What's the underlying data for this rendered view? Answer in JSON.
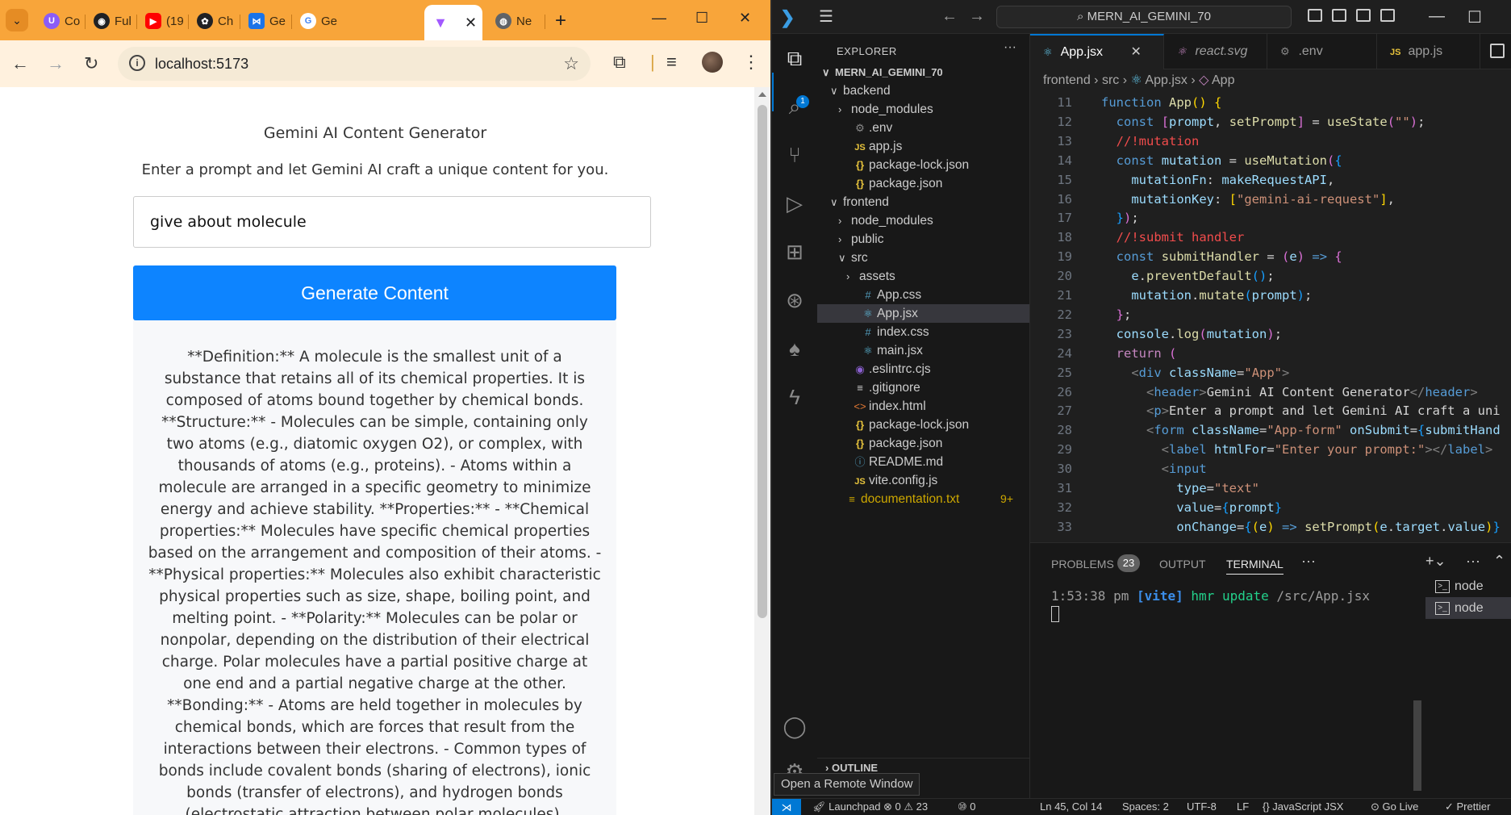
{
  "browser": {
    "tabs": [
      {
        "label": "Co",
        "icon": "u-circle-icon",
        "color": "#8b5cf6"
      },
      {
        "label": "Ful",
        "icon": "github-icon",
        "color": "#202124"
      },
      {
        "label": "(19",
        "icon": "youtube-icon",
        "color": "#ff0000"
      },
      {
        "label": "Ch",
        "icon": "chatgpt-icon",
        "color": "#202124"
      },
      {
        "label": "Ge",
        "icon": "butterfly-icon",
        "color": "#1a73e8"
      },
      {
        "label": "Ge",
        "icon": "google-icon",
        "color": "#4285f4"
      },
      {
        "label": "",
        "icon": "vite-icon",
        "color": "#a259ff"
      },
      {
        "label": "Ne",
        "icon": "globe-icon",
        "color": "#5f6368"
      }
    ],
    "url": "localhost:5173"
  },
  "app": {
    "header": "Gemini AI Content Generator",
    "description": "Enter a prompt and let Gemini AI craft a unique content for you.",
    "prompt_value": "give about molecule",
    "button_label": "Generate Content",
    "result_text": "**Definition:** A molecule is the smallest unit of a substance that retains all of its chemical properties. It is composed of atoms bound together by chemical bonds. **Structure:** - Molecules can be simple, containing only two atoms (e.g., diatomic oxygen O2), or complex, with thousands of atoms (e.g., proteins). - Atoms within a molecule are arranged in a specific geometry to minimize energy and achieve stability. **Properties:** - **Chemical properties:** Molecules have specific chemical properties based on the arrangement and composition of their atoms. - **Physical properties:** Molecules also exhibit characteristic physical properties such as size, shape, boiling point, and melting point. - **Polarity:** Molecules can be polar or nonpolar, depending on the distribution of their electrical charge. Polar molecules have a partial positive charge at one end and a partial negative charge at the other. **Bonding:** - Atoms are held together in molecules by chemical bonds, which are forces that result from the interactions between their electrons. - Common types of bonds include covalent bonds (sharing of electrons), ionic bonds (transfer of electrons), and hydrogen bonds (electrostatic attraction between polar molecules). **Biological"
  },
  "vscode": {
    "command_center": "MERN_AI_GEMINI_70",
    "explorer_title": "EXPLORER",
    "explorer_badge": "1",
    "project_name": "MERN_AI_GEMINI_70",
    "tree": [
      {
        "label": "MERN_AI_GEMINI_70",
        "depth": 0,
        "chev": "∨",
        "icon": "",
        "kind": "root"
      },
      {
        "label": "backend",
        "depth": 1,
        "chev": "∨",
        "icon": "",
        "kind": "folder"
      },
      {
        "label": "node_modules",
        "depth": 2,
        "chev": "›",
        "icon": "",
        "kind": "folder"
      },
      {
        "label": ".env",
        "depth": 2,
        "chev": "",
        "icon": "⚙",
        "kind": "gear"
      },
      {
        "label": "app.js",
        "depth": 2,
        "chev": "",
        "icon": "JS",
        "kind": "js"
      },
      {
        "label": "package-lock.json",
        "depth": 2,
        "chev": "",
        "icon": "{}",
        "kind": "json"
      },
      {
        "label": "package.json",
        "depth": 2,
        "chev": "",
        "icon": "{}",
        "kind": "json"
      },
      {
        "label": "frontend",
        "depth": 1,
        "chev": "∨",
        "icon": "",
        "kind": "folder"
      },
      {
        "label": "node_modules",
        "depth": 2,
        "chev": "›",
        "icon": "",
        "kind": "folder"
      },
      {
        "label": "public",
        "depth": 2,
        "chev": "›",
        "icon": "",
        "kind": "folder"
      },
      {
        "label": "src",
        "depth": 2,
        "chev": "∨",
        "icon": "",
        "kind": "folder"
      },
      {
        "label": "assets",
        "depth": 3,
        "chev": "›",
        "icon": "",
        "kind": "folder"
      },
      {
        "label": "App.css",
        "depth": 3,
        "chev": "",
        "icon": "#",
        "kind": "css"
      },
      {
        "label": "App.jsx",
        "depth": 3,
        "chev": "",
        "icon": "⚛",
        "kind": "jsx",
        "selected": true
      },
      {
        "label": "index.css",
        "depth": 3,
        "chev": "",
        "icon": "#",
        "kind": "css"
      },
      {
        "label": "main.jsx",
        "depth": 3,
        "chev": "",
        "icon": "⚛",
        "kind": "jsx"
      },
      {
        "label": ".eslintrc.cjs",
        "depth": 2,
        "chev": "",
        "icon": "◉",
        "kind": "eslint"
      },
      {
        "label": ".gitignore",
        "depth": 2,
        "chev": "",
        "icon": "≡",
        "kind": "txt"
      },
      {
        "label": "index.html",
        "depth": 2,
        "chev": "",
        "icon": "<>",
        "kind": "html"
      },
      {
        "label": "package-lock.json",
        "depth": 2,
        "chev": "",
        "icon": "{}",
        "kind": "json"
      },
      {
        "label": "package.json",
        "depth": 2,
        "chev": "",
        "icon": "{}",
        "kind": "json"
      },
      {
        "label": "README.md",
        "depth": 2,
        "chev": "",
        "icon": "ⓘ",
        "kind": "info"
      },
      {
        "label": "vite.config.js",
        "depth": 2,
        "chev": "",
        "icon": "JS",
        "kind": "js"
      },
      {
        "label": "documentation.txt",
        "depth": 1,
        "chev": "",
        "icon": "≡",
        "kind": "warn",
        "badge": "9+"
      }
    ],
    "outline_label": "OUTLINE",
    "tooltip": "Open a Remote Window",
    "editor_tabs": [
      {
        "label": "App.jsx",
        "icon": "⚛",
        "active": true
      },
      {
        "label": "react.svg",
        "icon": "⚛",
        "active": false
      },
      {
        "label": ".env",
        "icon": "⚙",
        "active": false
      },
      {
        "label": "app.js",
        "icon": "JS",
        "active": false
      }
    ],
    "breadcrumbs": [
      "frontend",
      "src",
      "App.jsx",
      "App"
    ],
    "code_lines": [
      {
        "n": "11",
        "html": "<span class='k'>function</span> <span class='f'>App</span><span class='br1'>()</span> <span class='br1'>{</span>"
      },
      {
        "n": "12",
        "html": "  <span class='k'>const</span> <span class='br2'>[</span><span class='v'>prompt</span>, <span class='f'>setPrompt</span><span class='br2'>]</span> = <span class='f'>useState</span><span class='br2'>(</span><span class='s'>\"\"</span><span class='br2'>)</span>;"
      },
      {
        "n": "13",
        "html": "  <span class='c'>//!mutation</span>"
      },
      {
        "n": "14",
        "html": "  <span class='k'>const</span> <span class='v'>mutation</span> = <span class='f'>useMutation</span><span class='br2'>(</span><span class='br3'>{</span>"
      },
      {
        "n": "15",
        "html": "    <span class='v'>mutationFn</span>: <span class='v'>makeRequestAPI</span>,"
      },
      {
        "n": "16",
        "html": "    <span class='v'>mutationKey</span>: <span class='br1'>[</span><span class='s'>\"gemini-ai-request\"</span><span class='br1'>]</span>,"
      },
      {
        "n": "17",
        "html": "  <span class='br3'>}</span><span class='br2'>)</span>;"
      },
      {
        "n": "18",
        "html": "  <span class='c'>//!submit handler</span>"
      },
      {
        "n": "19",
        "html": "  <span class='k'>const</span> <span class='f'>submitHandler</span> = <span class='br2'>(</span><span class='v'>e</span><span class='br2'>)</span> <span class='k'>=&gt;</span> <span class='br2'>{</span>"
      },
      {
        "n": "20",
        "html": "    <span class='v'>e</span>.<span class='f'>preventDefault</span><span class='br3'>()</span>;"
      },
      {
        "n": "21",
        "html": "    <span class='v'>mutation</span>.<span class='f'>mutate</span><span class='br3'>(</span><span class='v'>prompt</span><span class='br3'>)</span>;"
      },
      {
        "n": "22",
        "html": "  <span class='br2'>}</span>;"
      },
      {
        "n": "23",
        "html": "  <span class='v'>console</span>.<span class='f'>log</span><span class='br2'>(</span><span class='v'>mutation</span><span class='br2'>)</span>;"
      },
      {
        "n": "24",
        "html": "  <span class='kc'>return</span> <span class='br2'>(</span>"
      },
      {
        "n": "25",
        "html": "    <span class='tg'>&lt;</span><span class='t'>div</span> <span class='a'>className</span>=<span class='s'>\"App\"</span><span class='tg'>&gt;</span>"
      },
      {
        "n": "26",
        "html": "      <span class='tg'>&lt;</span><span class='t'>header</span><span class='tg'>&gt;</span><span class='p'>Gemini AI Content Generator</span><span class='tg'>&lt;/</span><span class='t'>header</span><span class='tg'>&gt;</span>"
      },
      {
        "n": "27",
        "html": "      <span class='tg'>&lt;</span><span class='t'>p</span><span class='tg'>&gt;</span><span class='p'>Enter a prompt and let Gemini AI craft a uni</span>"
      },
      {
        "n": "28",
        "html": "      <span class='tg'>&lt;</span><span class='t'>form</span> <span class='a'>className</span>=<span class='s'>\"App-form\"</span> <span class='a'>onSubmit</span>=<span class='br3'>{</span><span class='v'>submitHand</span>"
      },
      {
        "n": "29",
        "html": "        <span class='tg'>&lt;</span><span class='t'>label</span> <span class='a'>htmlFor</span>=<span class='s'>\"Enter your prompt:\"</span><span class='tg'>&gt;&lt;/</span><span class='t'>label</span><span class='tg'>&gt;</span>"
      },
      {
        "n": "30",
        "html": "        <span class='tg'>&lt;</span><span class='t'>input</span>"
      },
      {
        "n": "31",
        "html": "          <span class='a'>type</span>=<span class='s'>\"text\"</span>"
      },
      {
        "n": "32",
        "html": "          <span class='a'>value</span>=<span class='br3'>{</span><span class='v'>prompt</span><span class='br3'>}</span>"
      },
      {
        "n": "33",
        "html": "          <span class='a'>onChange</span>=<span class='br3'>{</span><span class='br1'>(</span><span class='v'>e</span><span class='br1'>)</span> <span class='k'>=&gt;</span> <span class='f'>setPrompt</span><span class='br1'>(</span><span class='v'>e</span>.<span class='v'>target</span>.<span class='v'>value</span><span class='br1'>)</span><span class='br3'>}</span>"
      }
    ],
    "panel_tabs": {
      "problems": "PROBLEMS",
      "problems_count": "23",
      "output": "OUTPUT",
      "terminal": "TERMINAL"
    },
    "terminal": {
      "time": "1:53:38 pm",
      "tag": "[vite]",
      "msg": "hmr update",
      "path": "/src/App.jsx"
    },
    "terminals": [
      "node",
      "node"
    ],
    "status": {
      "launchpad": "Launchpad",
      "problems": "⊗ 0 ⚠ 23",
      "ports": "⑩ 0",
      "position": "Ln 45, Col 14",
      "spaces": "Spaces: 2",
      "encoding": "UTF-8",
      "eol": "LF",
      "language": "{} JavaScript JSX",
      "golive": "⊙ Go Live",
      "prettier": "✓ Prettier"
    }
  }
}
